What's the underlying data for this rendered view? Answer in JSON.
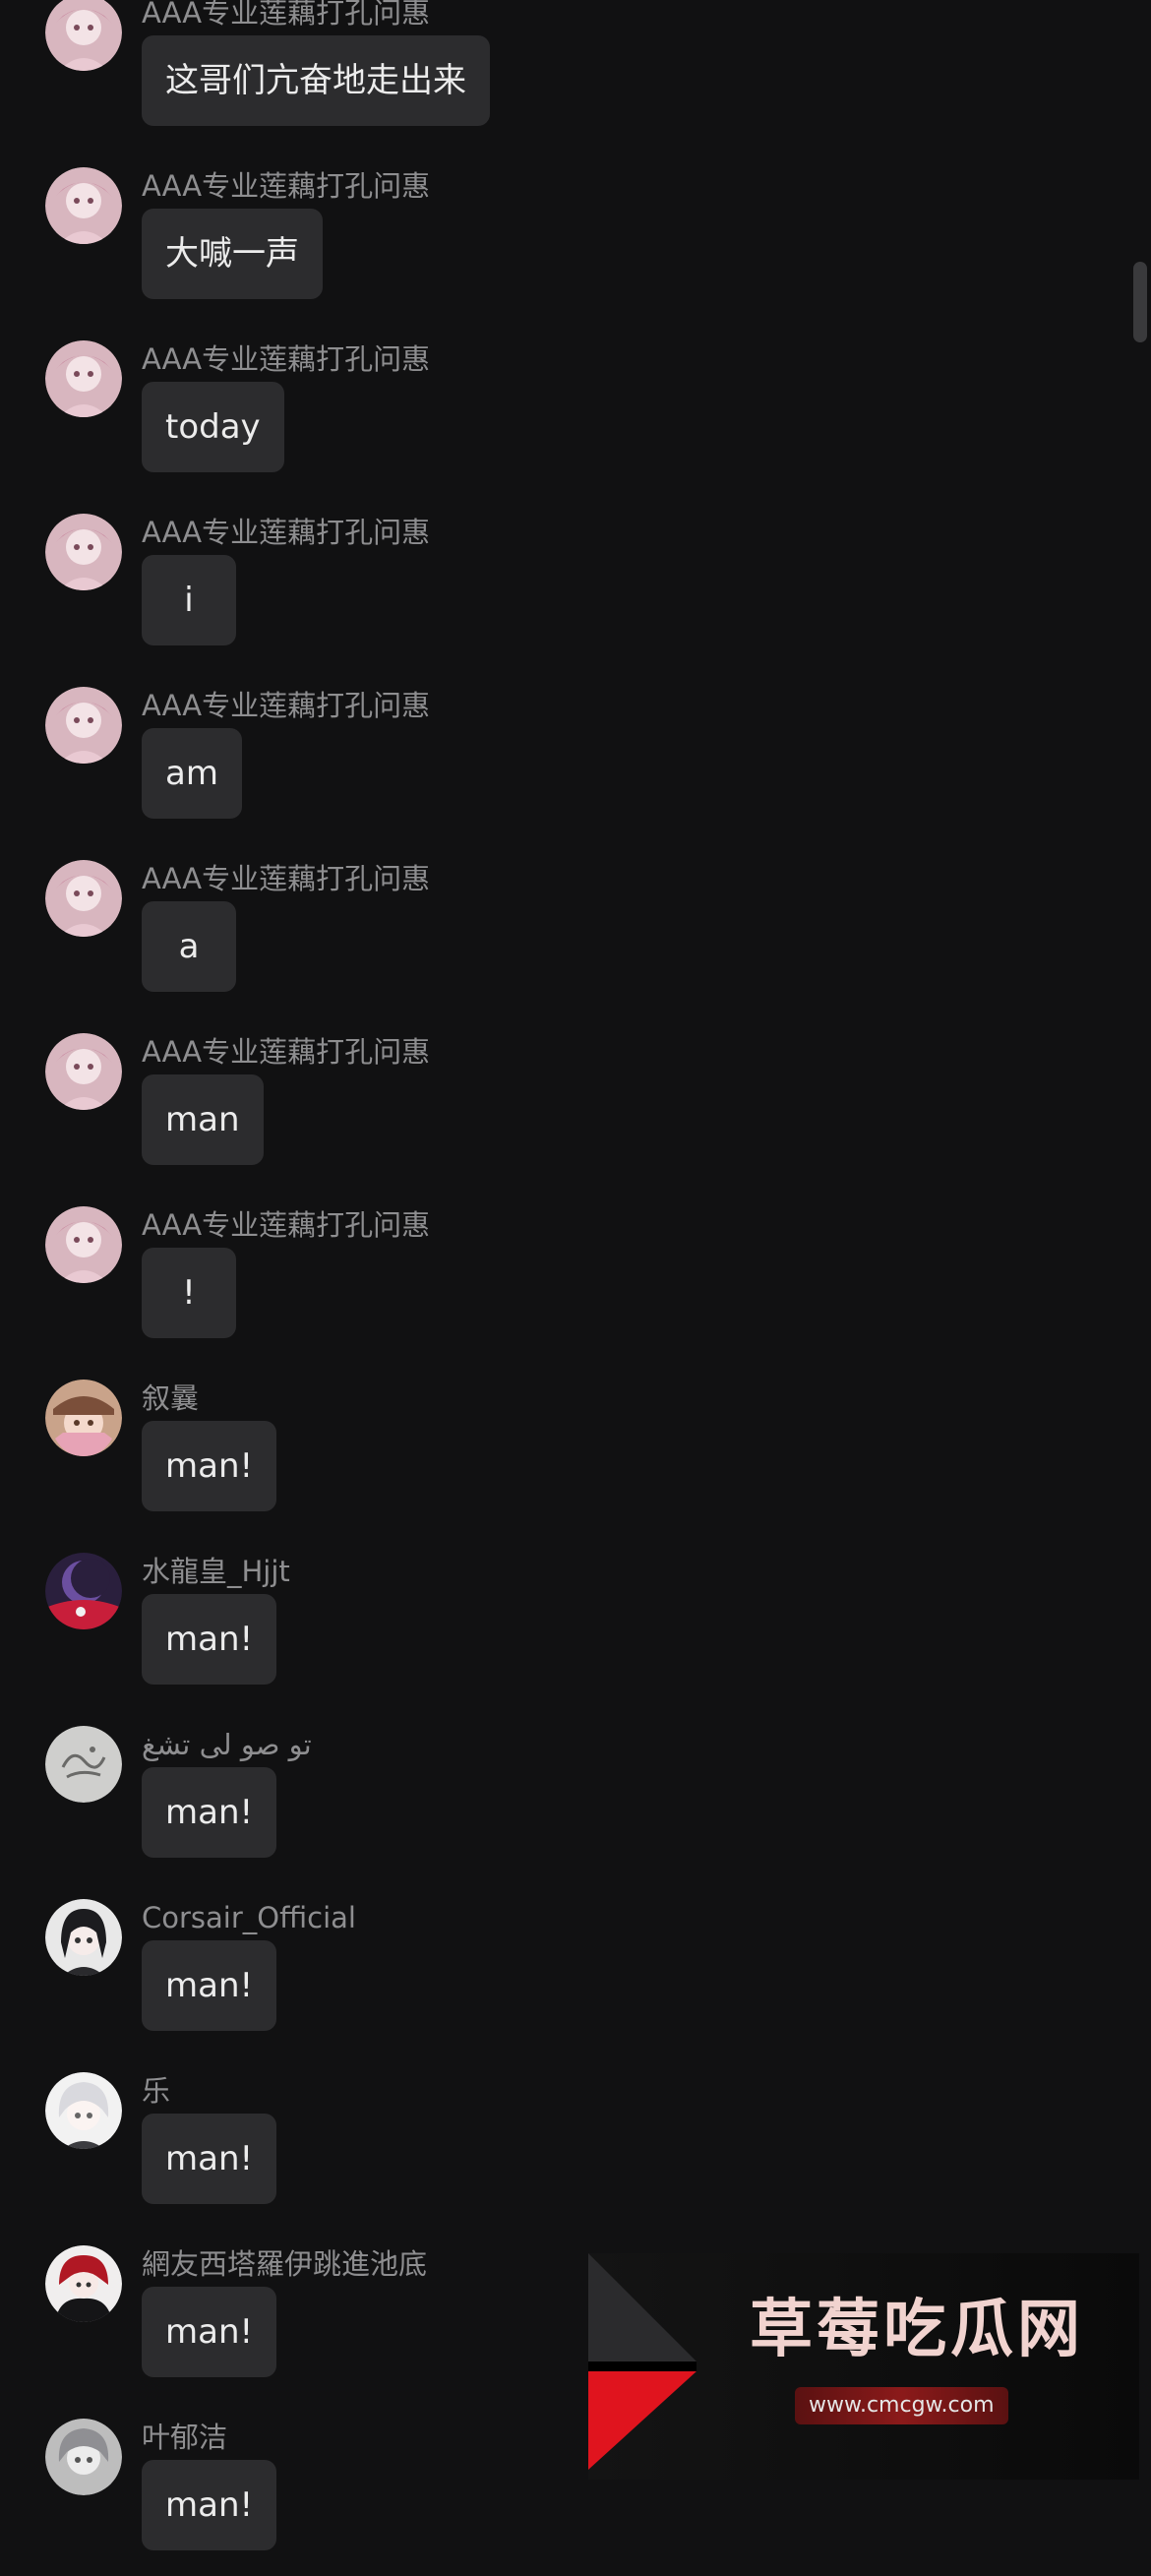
{
  "colors": {
    "background": "#111112",
    "bubble": "#2c2c2e",
    "username": "#8e8e90",
    "message_text": "#ececec"
  },
  "messages": [
    {
      "username": "AAA专业莲藕打孔问惠",
      "text": "这哥们亢奋地走出来",
      "avatar": "pink-anime-avatar-icon"
    },
    {
      "username": "AAA专业莲藕打孔问惠",
      "text": "大喊一声",
      "avatar": "pink-anime-avatar-icon"
    },
    {
      "username": "AAA专业莲藕打孔问惠",
      "text": "today",
      "avatar": "pink-anime-avatar-icon"
    },
    {
      "username": "AAA专业莲藕打孔问惠",
      "text": "i",
      "avatar": "pink-anime-avatar-icon"
    },
    {
      "username": "AAA专业莲藕打孔问惠",
      "text": "am",
      "avatar": "pink-anime-avatar-icon"
    },
    {
      "username": "AAA专业莲藕打孔问惠",
      "text": "a",
      "avatar": "pink-anime-avatar-icon"
    },
    {
      "username": "AAA专业莲藕打孔问惠",
      "text": "man",
      "avatar": "pink-anime-avatar-icon"
    },
    {
      "username": "AAA专业莲藕打孔问惠",
      "text": "!",
      "avatar": "pink-anime-avatar-icon"
    },
    {
      "username": "叙曩",
      "text": "man!",
      "avatar": "anime-hat-avatar-icon"
    },
    {
      "username": "水龍皇_Hjjt",
      "text": "man!",
      "avatar": "dark-moon-avatar-icon"
    },
    {
      "username": "تو صو لی تشغ",
      "text": "man!",
      "avatar": "calligraphy-avatar-icon"
    },
    {
      "username": "Corsair_Official",
      "text": "man!",
      "avatar": "dark-hair-avatar-icon"
    },
    {
      "username": "乐",
      "text": "man!",
      "avatar": "white-hair-avatar-icon"
    },
    {
      "username": "網友西塔羅伊跳進池底",
      "text": "man!",
      "avatar": "red-dark-avatar-icon"
    },
    {
      "username": "叶郁洁",
      "text": "man!",
      "avatar": "gray-anime-avatar-icon"
    }
  ],
  "watermark": {
    "title": "草莓吃瓜网",
    "url": "www.cmcgw.com"
  }
}
